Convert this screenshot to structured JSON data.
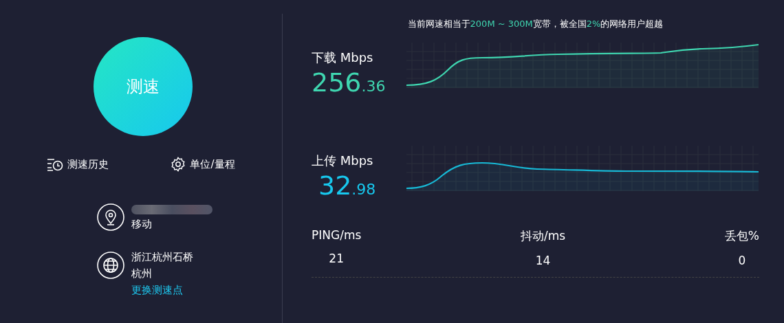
{
  "start_button": {
    "label": "测速"
  },
  "actions": [
    {
      "kind": "history",
      "label": "测速历史"
    },
    {
      "kind": "settings",
      "label": "单位/量程"
    }
  ],
  "isp": {
    "label": "移动"
  },
  "server": {
    "location": "浙江杭州石桥",
    "city": "杭州",
    "link": "更换测速点"
  },
  "summary": [
    {
      "text": "当前网速相当于",
      "highlight": false
    },
    {
      "text": "200M ~ 300M",
      "highlight": true
    },
    {
      "text": "宽带，被全国",
      "highlight": false
    },
    {
      "text": "2%",
      "highlight": true
    },
    {
      "text": "的网络用户超越",
      "highlight": false
    }
  ],
  "speeds": [
    {
      "kind": "download",
      "label": "下载 Mbps",
      "whole": "256",
      "fraction": ".36"
    },
    {
      "kind": "upload",
      "label": "上传 Mbps",
      "whole": "32",
      "fraction": ".98"
    }
  ],
  "stats": [
    {
      "label": "PING/ms",
      "value": "21"
    },
    {
      "label": "抖动/ms",
      "value": "14"
    },
    {
      "label": "丢包%",
      "value": "0"
    }
  ]
}
